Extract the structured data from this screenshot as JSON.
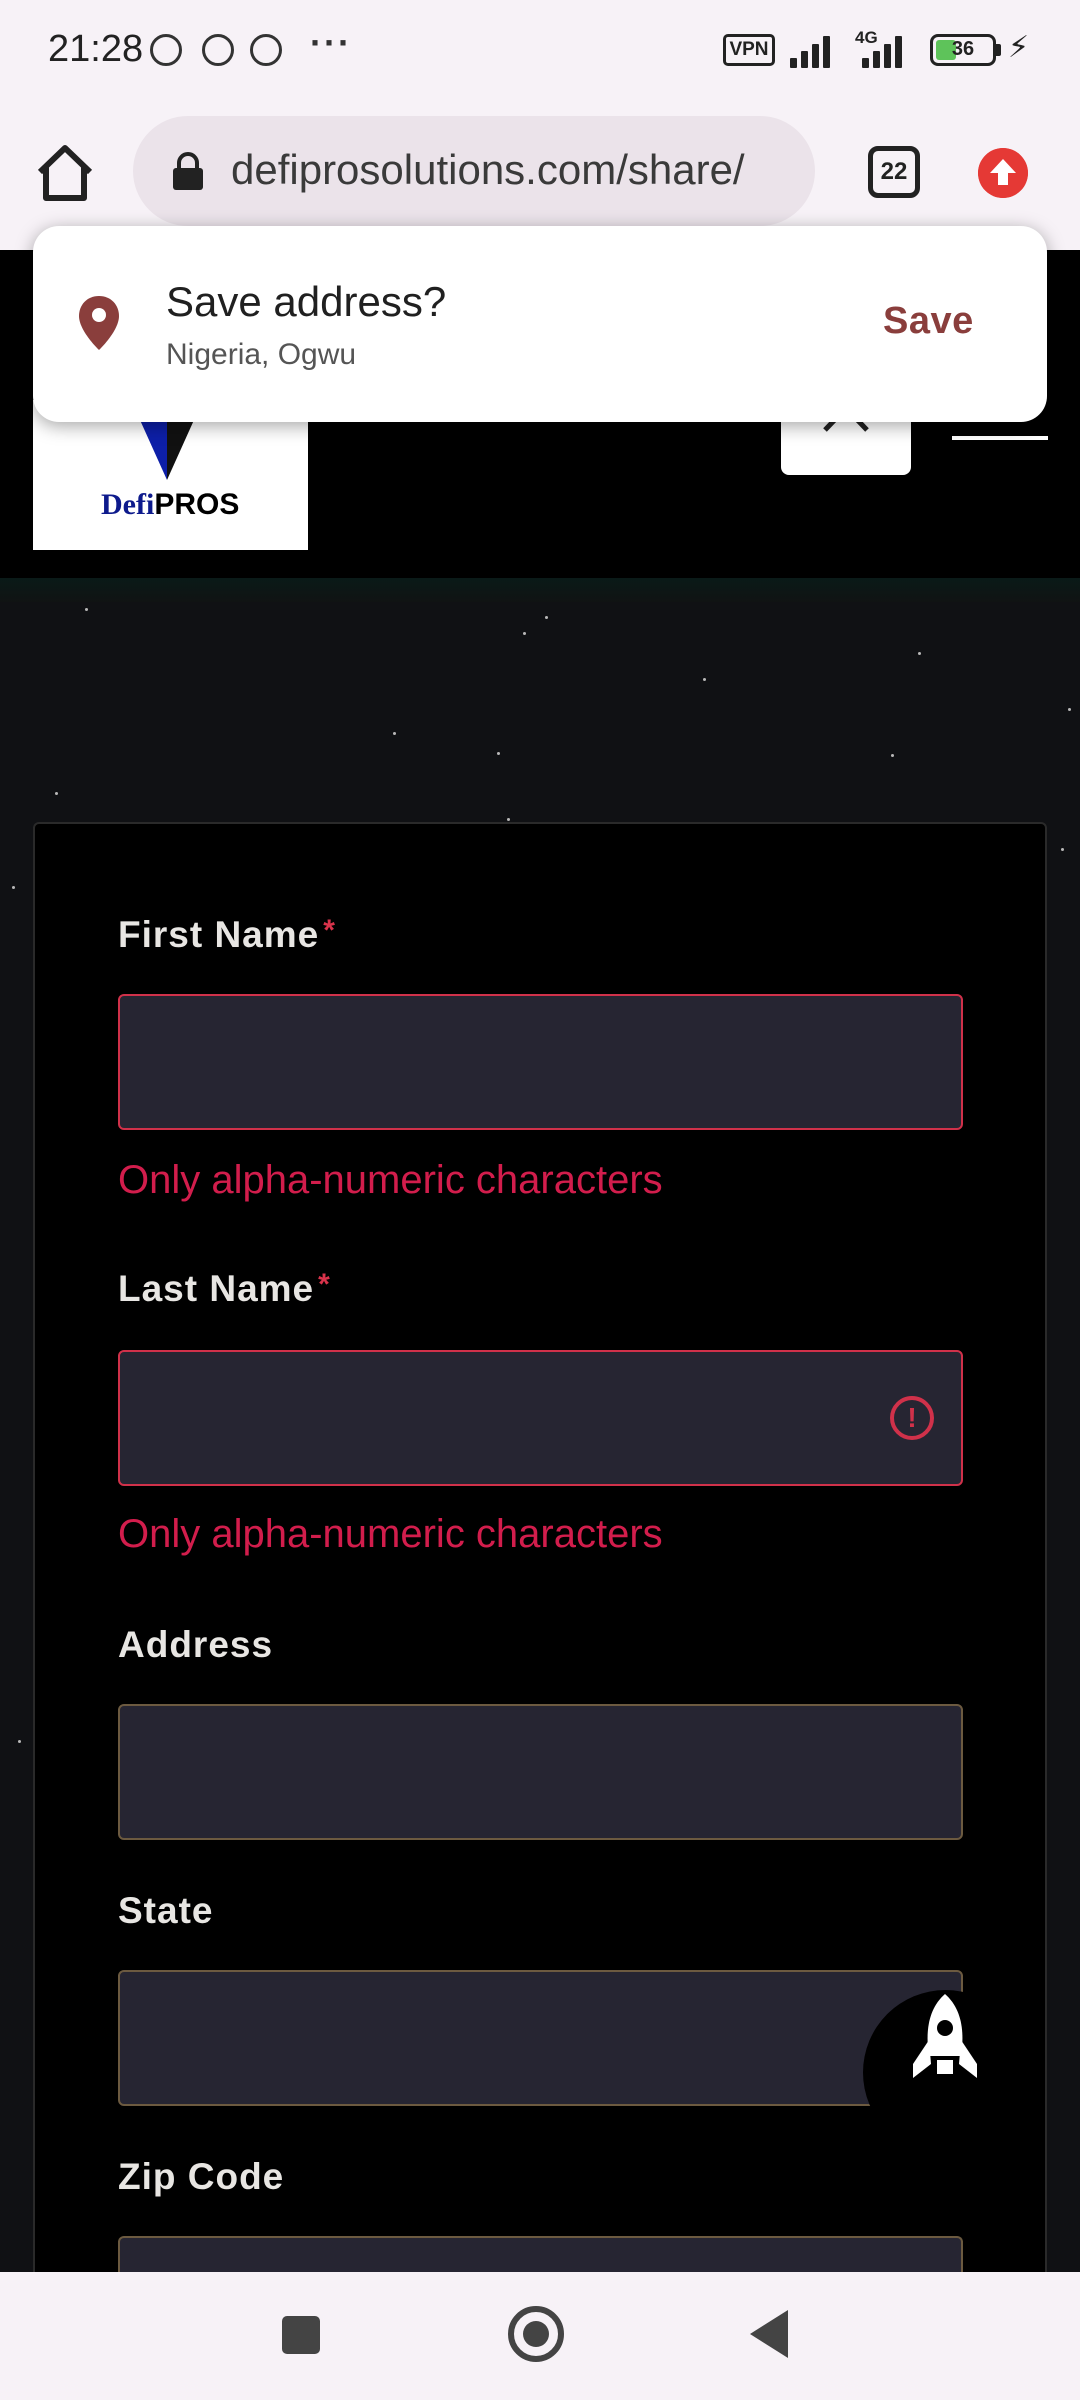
{
  "status_bar": {
    "time": "21:28",
    "vpn": "VPN",
    "network": "4G",
    "battery": "36"
  },
  "browser": {
    "url": "defiprosolutions.com/share/",
    "tab_count": "22"
  },
  "popup": {
    "title": "Save address?",
    "subtitle": "Nigeria, Ogwu",
    "action": "Save"
  },
  "header": {
    "logo_prefix": "Defi",
    "logo_suffix": "PROS"
  },
  "form": {
    "required_mark": "*",
    "fields": [
      {
        "label": "First Name",
        "required": true,
        "value": "",
        "error": "Only alpha-numeric characters"
      },
      {
        "label": "Last Name",
        "required": true,
        "value": "",
        "error": "Only alpha-numeric characters"
      },
      {
        "label": "Address",
        "required": false,
        "value": ""
      },
      {
        "label": "State",
        "required": false,
        "value": ""
      },
      {
        "label": "Zip Code",
        "required": false,
        "value": ""
      }
    ]
  },
  "colors": {
    "error": "#d21d4c",
    "popup_action": "#8a3e3c",
    "input_bg": "#262532"
  }
}
